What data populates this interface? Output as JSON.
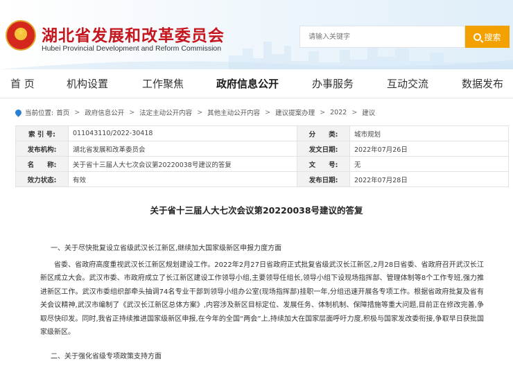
{
  "header": {
    "title": "湖北省发展和改革委员会",
    "subtitle": "Hubei Provincial Development and Reform Commission",
    "emblem_icon": "national-emblem-icon",
    "search_placeholder": "请输入关键字",
    "search_button": "搜索"
  },
  "nav": {
    "items": [
      "首 页",
      "机构设置",
      "工作聚焦",
      "政府信息公开",
      "办事服务",
      "互动交流",
      "数据发布"
    ],
    "active": "政府信息公开"
  },
  "breadcrumb": {
    "label": "当前位置:",
    "items": [
      "首页",
      "政府信息公开",
      "法定主动公开内容",
      "其他主动公开内容",
      "建议提案办理",
      "2022",
      "建议"
    ]
  },
  "info": {
    "index_label": "索 引 号:",
    "index_value": "011043110/2022-30418",
    "category_label": "分　　类:",
    "category_value": "城市规划",
    "issuer_label": "发布机构:",
    "issuer_value": "湖北省发展和改革委员会",
    "issue_date_label": "发文日期:",
    "issue_date_value": "2022年07月26日",
    "name_label": "名　　称:",
    "name_value": "关于省十三届人大七次会议第20220038号建议的答复",
    "doc_no_label": "文　　号:",
    "doc_no_value": "无",
    "status_label": "效力状态:",
    "status_value": "有效",
    "publish_date_label": "发布日期:",
    "publish_date_value": "2022年07月28日"
  },
  "article": {
    "title": "关于省十三届人大七次会议第20220038号建议的答复",
    "heading1": "一、关于尽快批复设立省级武汉长江新区,继续加大国家级新区申报力度方面",
    "paragraph1": "省委、省政府高度重视武汉长江新区规划建设工作。2022年2月27日省政府正式批复省级武汉长江新区,2月28日省委、省政府召开武汉长江新区成立大会。武汉市委、市政府成立了长江新区建设工作领导小组,主要领导任组长,领导小组下设现场指挥部、管理体制等8个工作专班,强力推进新区工作。武汉市委组织部牵头抽调74名专业干部到领导小组办公室(现场指挥部)挂职一年,分组迅速开展各专项工作。根据省政府批复及省有关会议精神,武汉市编制了《武汉长江新区总体方案》,内容涉及新区目标定位、发展任务、体制机制、保障措施等重大问题,目前正在修改完善,争取尽快印发。同时,我省正持续推进国家级新区申报,在今年的全国“两会”上,持续加大在国家层面呼吁力度,积极与国家发改委衔接,争取早日获批国家级新区。",
    "heading2": "二、关于强化省级专项政策支持方面"
  },
  "colors": {
    "brand_red": "#c5161d",
    "search_orange": "#f2a100",
    "location_blue": "#2b7fd3"
  }
}
